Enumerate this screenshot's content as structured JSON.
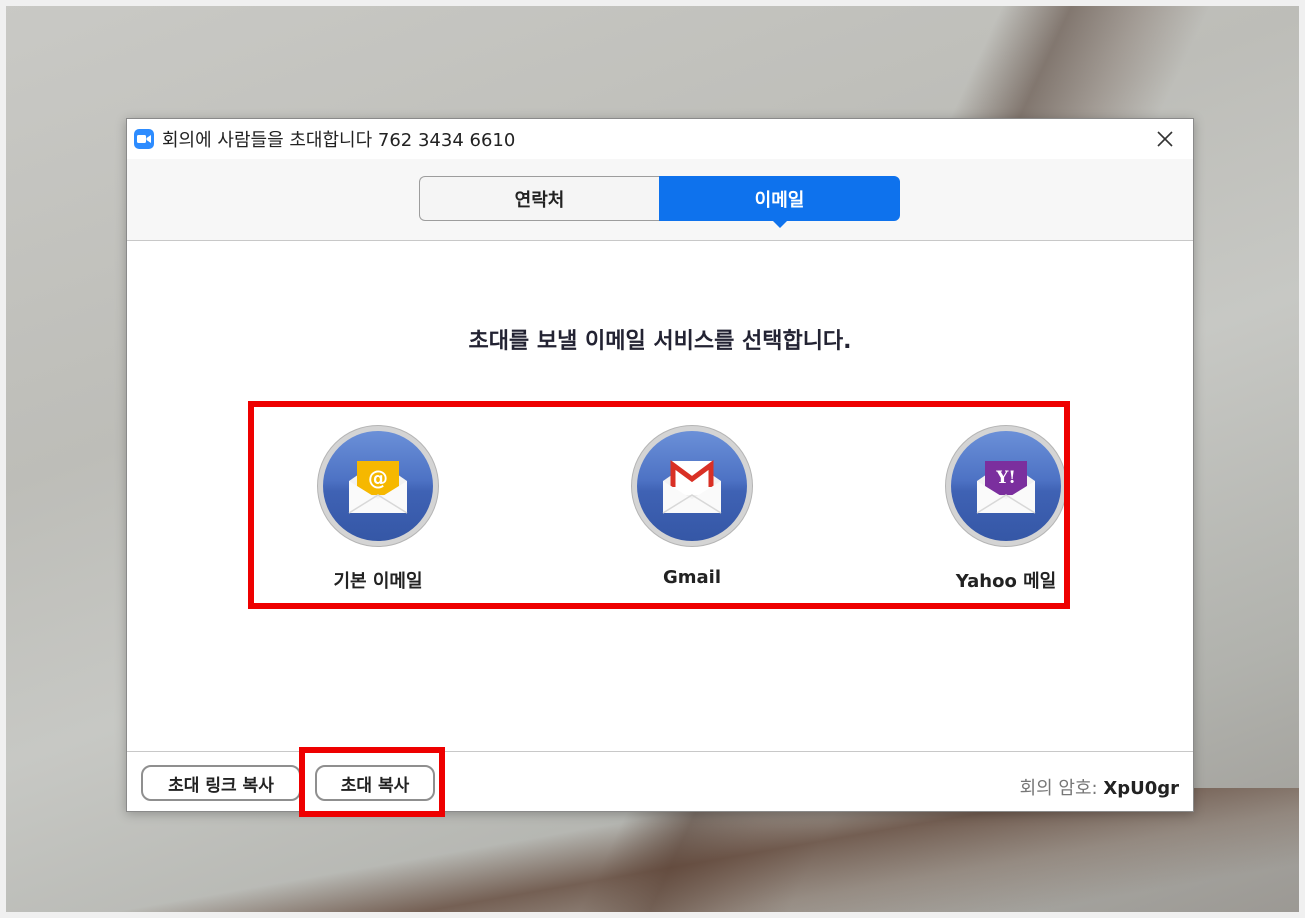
{
  "window": {
    "title": "회의에 사람들을 초대합니다 762 3434 6610",
    "close_symbol": "×"
  },
  "tabs": [
    {
      "label": "연락처",
      "active": false
    },
    {
      "label": "이메일",
      "active": true
    }
  ],
  "prompt": "초대를 보낼 이메일 서비스를 선택합니다.",
  "services": [
    {
      "label": "기본 이메일",
      "icon": "default-mail-icon"
    },
    {
      "label": "Gmail",
      "icon": "gmail-icon"
    },
    {
      "label": "Yahoo 메일",
      "icon": "yahoo-mail-icon"
    }
  ],
  "footer": {
    "copy_link_label": "초대 링크 복사",
    "copy_invite_label": "초대 복사",
    "password_label": "회의 암호: ",
    "password_value": "XpU0gr"
  },
  "colors": {
    "accent": "#0e72ed",
    "highlight": "#ee0000",
    "service_circle": "#4d72c4"
  }
}
